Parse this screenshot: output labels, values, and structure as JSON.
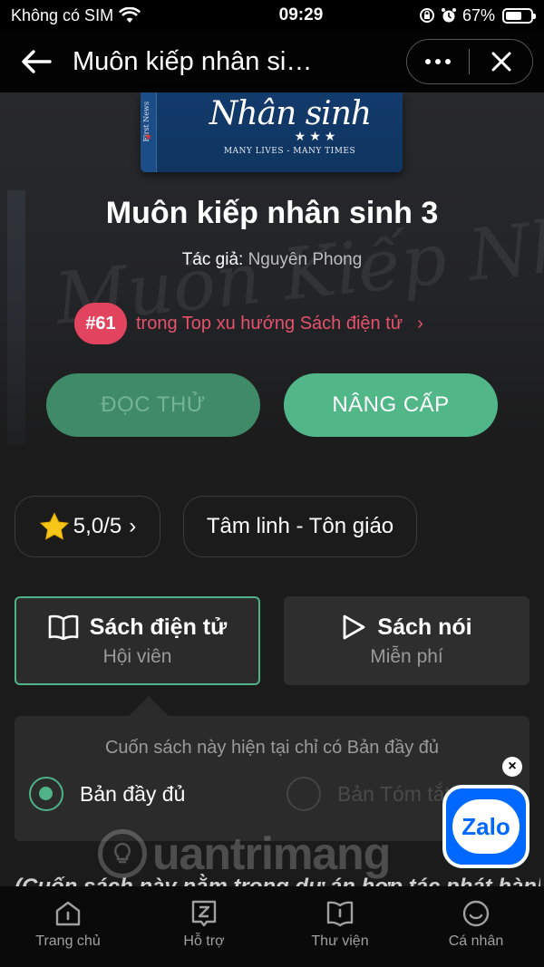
{
  "status_bar": {
    "carrier": "Không có SIM",
    "time": "09:29",
    "battery": "67%",
    "battery_level": 0.67
  },
  "nav": {
    "title": "Muôn kiếp nhân si…",
    "icons": [
      "back-arrow-icon",
      "more-dots-icon",
      "close-icon"
    ]
  },
  "cover": {
    "spine_text": "First News",
    "title": "Nhân sinh",
    "stars": "★★★",
    "subtitle": "MANY LIVES - MANY TIMES"
  },
  "hero_background_text": "Muôn Kiếp Nhân Sinh",
  "book": {
    "title": "Muôn kiếp nhân sinh 3",
    "author_label": "Tác giả:",
    "author_name": "Nguyên Phong",
    "rank_badge": "#61",
    "rank_text": "trong Top xu hướng Sách điện tử"
  },
  "actions": {
    "read_sample": "ĐỌC THỬ",
    "upgrade": "NÂNG CẤP"
  },
  "chips": {
    "rating": "5,0/5",
    "genre": "Tâm linh - Tôn giáo"
  },
  "formats": {
    "ebook": {
      "title": "Sách điện tử",
      "sub": "Hội viên"
    },
    "audio": {
      "title": "Sách nói",
      "sub": "Miễn phí"
    }
  },
  "version": {
    "note": "Cuốn sách này hiện tại chỉ có Bản đầy đủ",
    "full": "Bản đầy đủ",
    "summary": "Bản Tóm tắt"
  },
  "zalo": {
    "label": "Zalo"
  },
  "description_peek": "(Cuốn sách này nằm trong dự án hợp tác phát hành",
  "watermark": "uantrimang",
  "tabs": [
    {
      "label": "Trang chủ",
      "icon": "home-icon"
    },
    {
      "label": "Hỗ trợ",
      "icon": "support-icon"
    },
    {
      "label": "Thư viện",
      "icon": "library-icon"
    },
    {
      "label": "Cá nhân",
      "icon": "profile-icon"
    }
  ],
  "colors": {
    "accent": "#52b788",
    "rank": "#e2445f",
    "zalo": "#0068ff"
  }
}
